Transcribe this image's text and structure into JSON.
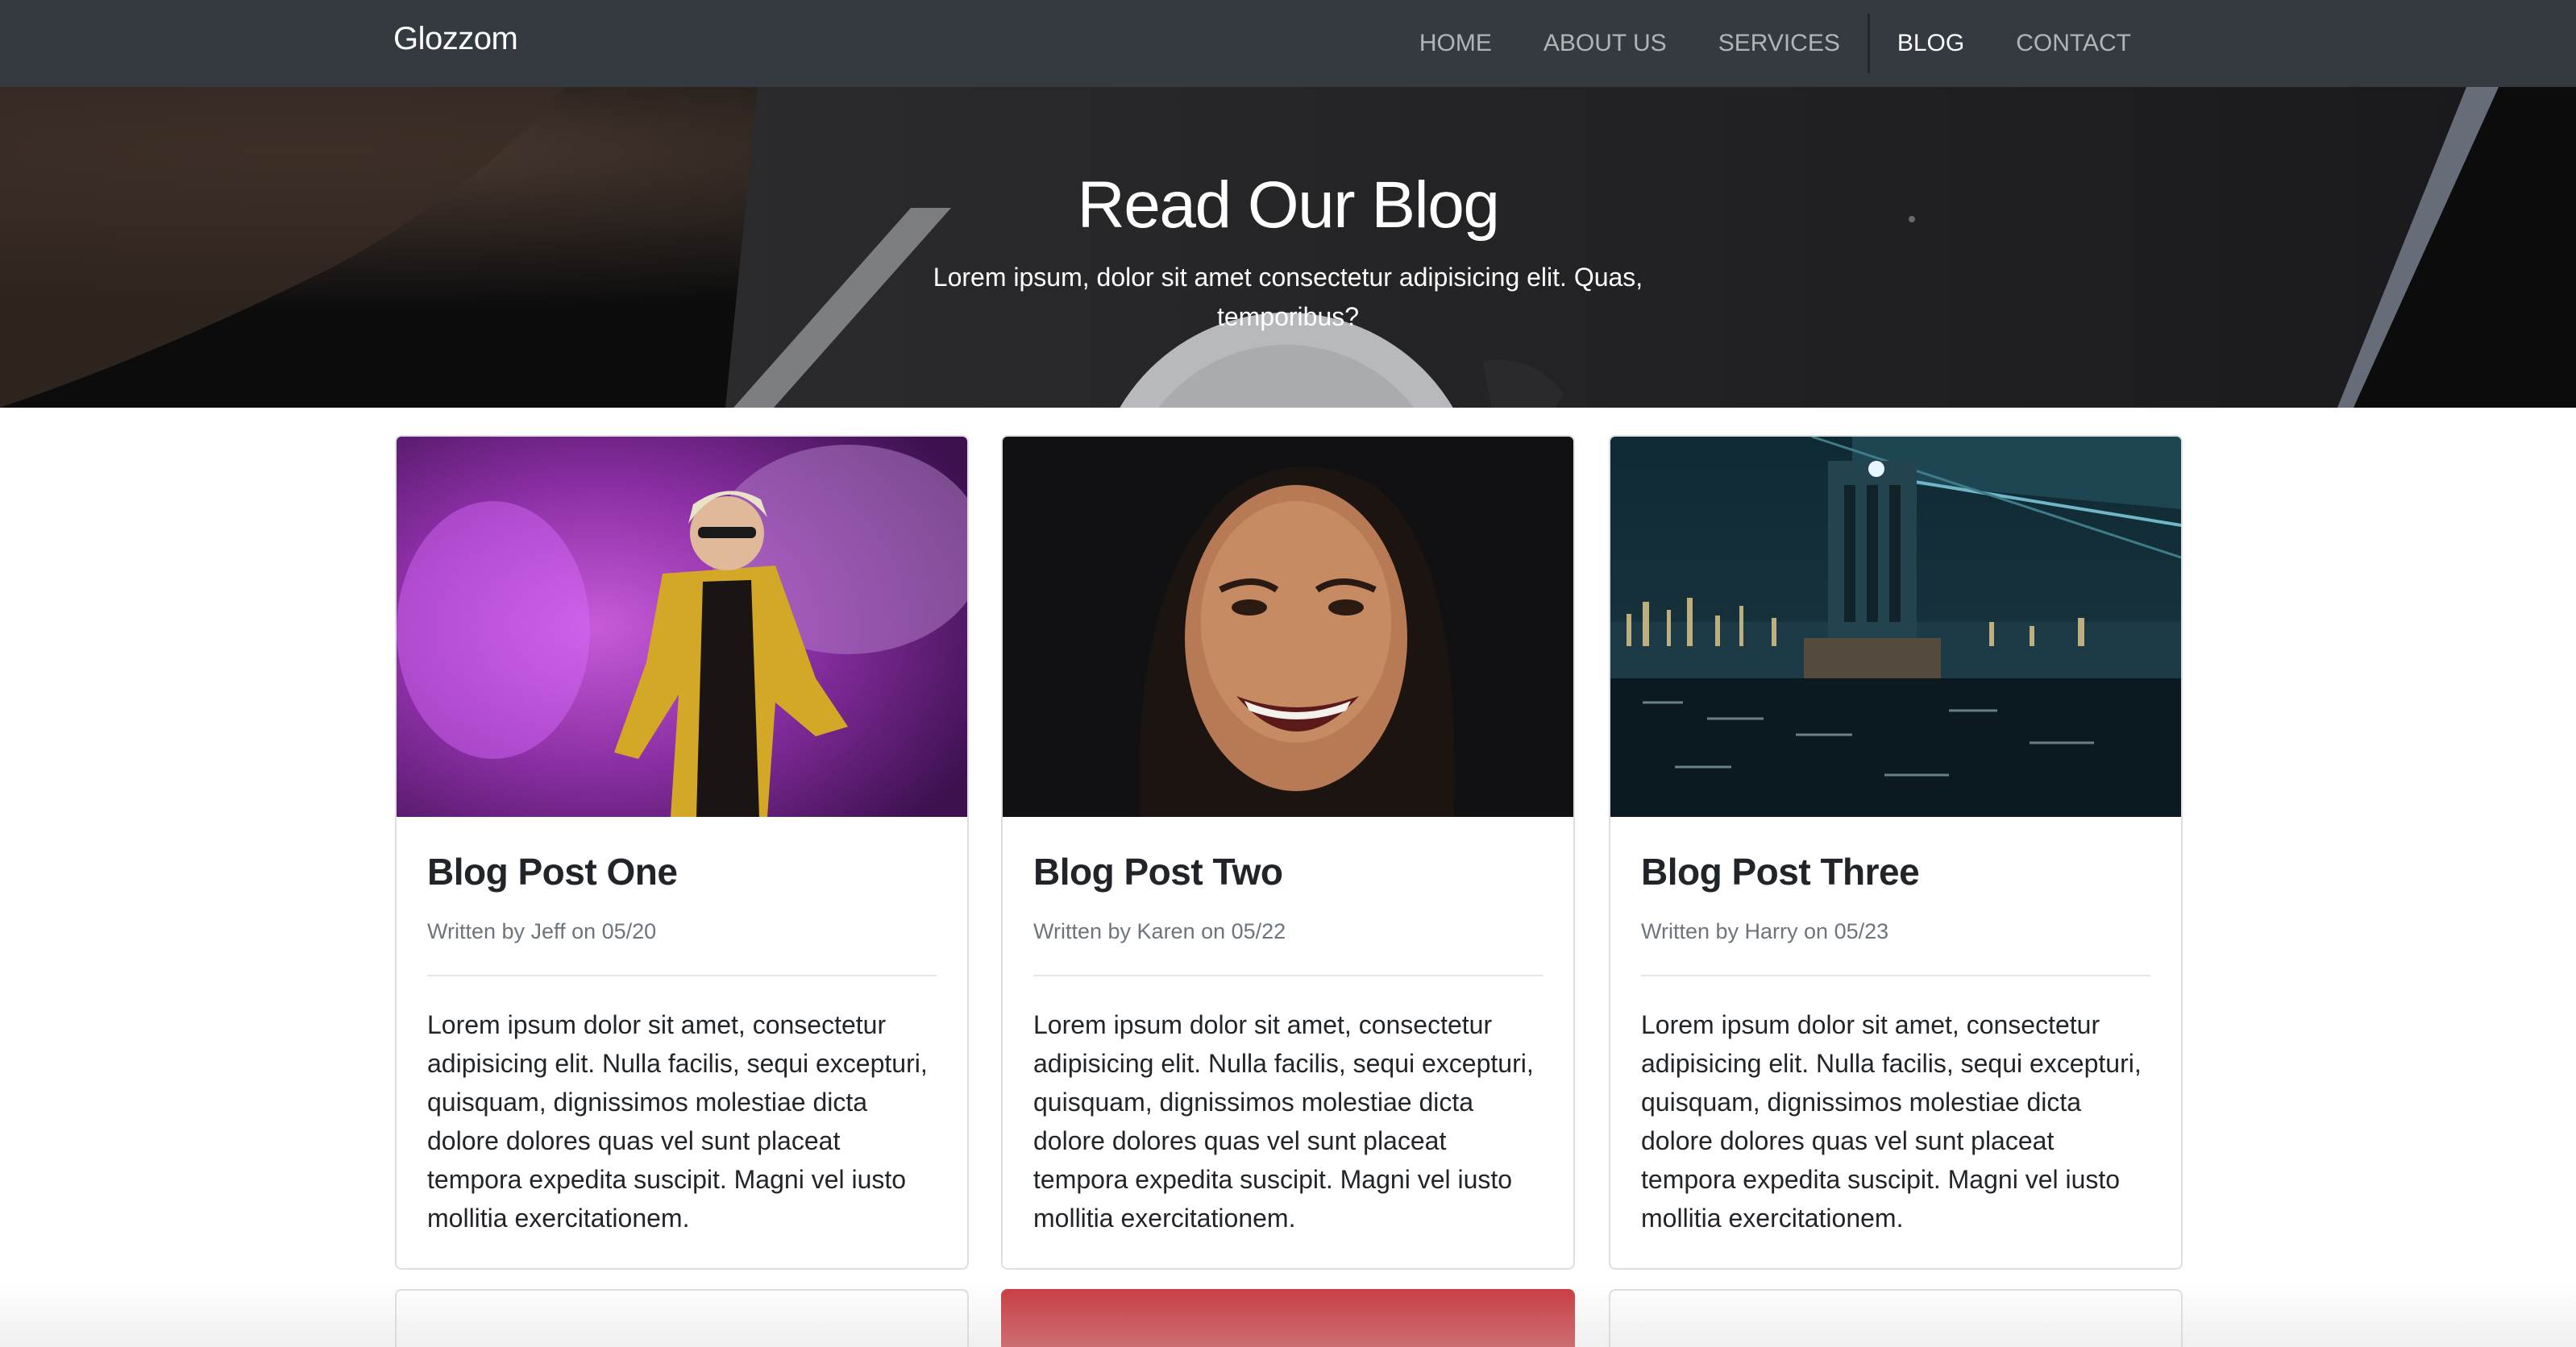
{
  "navbar": {
    "brand": "Glozzom",
    "links": [
      {
        "label": "HOME"
      },
      {
        "label": "ABOUT US"
      },
      {
        "label": "SERVICES"
      },
      {
        "label": "BLOG"
      },
      {
        "label": "CONTACT"
      }
    ],
    "active": "BLOG"
  },
  "hero": {
    "title": "Read Our Blog",
    "subtitle": "Lorem ipsum, dolor sit amet consectetur adipisicing elit. Quas, temporibus?"
  },
  "posts": [
    {
      "title": "Blog Post One",
      "meta": "Written by Jeff on 05/20",
      "body": "Lorem ipsum dolor sit amet, consectetur adipisicing elit. Nulla facilis, sequi excepturi, quisquam, dignissimos molestiae dicta dolore dolores quas vel sunt placeat tempora expedita suscipit. Magni vel iusto mollitia exercitationem.",
      "image": "person-yellow-jacket-purple-smoke"
    },
    {
      "title": "Blog Post Two",
      "meta": "Written by Karen on 05/22",
      "body": "Lorem ipsum dolor sit amet, consectetur adipisicing elit. Nulla facilis, sequi excepturi, quisquam, dignissimos molestiae dicta dolore dolores quas vel sunt placeat tempora expedita suscipit. Magni vel iusto mollitia exercitationem.",
      "image": "smiling-woman-portrait"
    },
    {
      "title": "Blog Post Three",
      "meta": "Written by Harry on 05/23",
      "body": "Lorem ipsum dolor sit amet, consectetur adipisicing elit. Nulla facilis, sequi excepturi, quisquam, dignissimos molestiae dicta dolore dolores quas vel sunt placeat tempora expedita suscipit. Magni vel iusto mollitia exercitationem.",
      "image": "bridge-city-night"
    }
  ],
  "colors": {
    "navbar_bg": "#343a40",
    "accent_red": "#c9393f",
    "meta_text": "#6c757d"
  }
}
